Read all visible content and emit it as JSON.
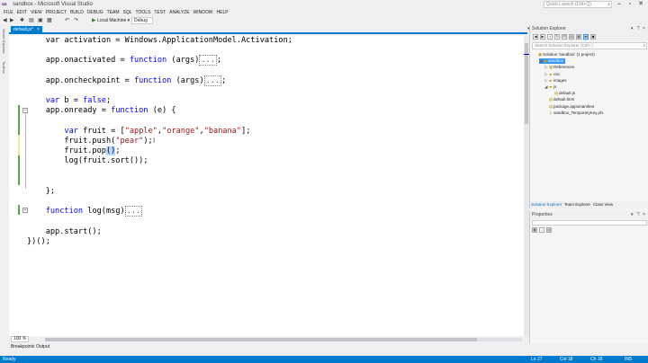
{
  "window": {
    "title": "sandbox - Microsoft Visual Studio",
    "quick_launch_placeholder": "Quick Launch (Ctrl+Q)",
    "logo": "visual-studio-logo"
  },
  "menu": [
    "FILE",
    "EDIT",
    "VIEW",
    "PROJECT",
    "BUILD",
    "DEBUG",
    "TEAM",
    "SQL",
    "TOOLS",
    "TEST",
    "ANALYZE",
    "WINDOW",
    "HELP"
  ],
  "toolbar": {
    "run_label": "Local Machine",
    "config": "Debug"
  },
  "left_strip": {
    "server_explorer": "Server Explorer",
    "toolbox": "Toolbox"
  },
  "editor": {
    "tab_label": "default.js*",
    "tab_close": "×",
    "lines": [
      {
        "parts": [
          [
            "t",
            "    var activation = Windows.ApplicationModel.Activation;"
          ]
        ]
      },
      {
        "parts": [
          [
            "t",
            ""
          ]
        ]
      },
      {
        "parts": [
          [
            "t",
            "    app.onactivated = "
          ],
          [
            "k",
            "function"
          ],
          [
            "t",
            " (args)"
          ],
          [
            "c",
            "..."
          ],
          [
            "t",
            ";"
          ]
        ]
      },
      {
        "parts": [
          [
            "t",
            ""
          ]
        ]
      },
      {
        "parts": [
          [
            "t",
            "    app.oncheckpoint = "
          ],
          [
            "k",
            "function"
          ],
          [
            "t",
            " (args)"
          ],
          [
            "c",
            "..."
          ],
          [
            "t",
            ";"
          ]
        ]
      },
      {
        "parts": [
          [
            "t",
            ""
          ]
        ]
      },
      {
        "parts": [
          [
            "t",
            "    "
          ],
          [
            "k",
            "var"
          ],
          [
            "t",
            " b = "
          ],
          [
            "k",
            "false"
          ],
          [
            "t",
            ";"
          ]
        ]
      },
      {
        "parts": [
          [
            "t",
            "    app.onready = "
          ],
          [
            "k",
            "function"
          ],
          [
            "t",
            " (e) {"
          ]
        ]
      },
      {
        "parts": [
          [
            "t",
            ""
          ]
        ]
      },
      {
        "parts": [
          [
            "t",
            "        "
          ],
          [
            "k",
            "var"
          ],
          [
            "t",
            " fruit = ["
          ],
          [
            "s",
            "\"apple\""
          ],
          [
            "t",
            ","
          ],
          [
            "s",
            "\"orange\""
          ],
          [
            "t",
            ","
          ],
          [
            "s",
            "\"banana\""
          ],
          [
            "t",
            "];"
          ]
        ]
      },
      {
        "parts": [
          [
            "t",
            "        fruit.push("
          ],
          [
            "s",
            "\"pear\""
          ],
          [
            "t",
            ");"
          ]
        ]
      },
      {
        "parts": [
          [
            "t",
            "        fruit.pop"
          ],
          [
            "h",
            "()"
          ],
          [
            "t",
            ";"
          ]
        ]
      },
      {
        "parts": [
          [
            "t",
            "        log(fruit.sort());"
          ]
        ]
      },
      {
        "parts": [
          [
            "t",
            ""
          ]
        ]
      },
      {
        "parts": [
          [
            "t",
            ""
          ]
        ]
      },
      {
        "parts": [
          [
            "t",
            "    };"
          ]
        ]
      },
      {
        "parts": [
          [
            "t",
            ""
          ]
        ]
      },
      {
        "parts": [
          [
            "t",
            "    "
          ],
          [
            "k",
            "function"
          ],
          [
            "t",
            " log(msg)"
          ],
          [
            "c",
            "..."
          ]
        ]
      },
      {
        "parts": [
          [
            "t",
            ""
          ]
        ]
      },
      {
        "parts": [
          [
            "t",
            "    app.start();"
          ]
        ]
      },
      {
        "parts": [
          [
            "t",
            "})();"
          ]
        ]
      }
    ],
    "zoom": "100 %",
    "outline_collapsed": "+",
    "outline_expanded": "−"
  },
  "bottom_tabs": [
    "Breakpoints",
    "Output"
  ],
  "status": {
    "left": "Ready",
    "ln": "Ln 27",
    "col": "Col 18",
    "ch": "Ch 18",
    "mode": "INS"
  },
  "solution_explorer": {
    "title": "Solution Explorer",
    "search_placeholder": "Search Solution Explorer (Ctrl+;)",
    "items": [
      {
        "label": "Solution 'sandbox' (1 project)",
        "indent": 0,
        "icon": "solution-icon",
        "exp": ""
      },
      {
        "label": "sandbox",
        "indent": 1,
        "icon": "project-icon",
        "exp": "◢",
        "selected": true
      },
      {
        "label": "References",
        "indent": 2,
        "icon": "references-icon",
        "exp": "▷"
      },
      {
        "label": "css",
        "indent": 2,
        "icon": "folder-icon",
        "exp": "▷"
      },
      {
        "label": "images",
        "indent": 2,
        "icon": "folder-icon",
        "exp": "▷"
      },
      {
        "label": "js",
        "indent": 2,
        "icon": "folder-icon",
        "exp": "◢"
      },
      {
        "label": "default.js",
        "indent": 3,
        "icon": "js-file-icon",
        "exp": ""
      },
      {
        "label": "default.html",
        "indent": 2,
        "icon": "html-file-icon",
        "exp": ""
      },
      {
        "label": "package.appxmanifest",
        "indent": 2,
        "icon": "manifest-icon",
        "exp": ""
      },
      {
        "label": "sandbox_TemporaryKey.pfx",
        "indent": 2,
        "icon": "key-icon",
        "exp": ""
      }
    ],
    "tabs": [
      "Solution Explorer",
      "Team Explorer",
      "Class View"
    ]
  },
  "properties": {
    "title": "Properties"
  },
  "colors": {
    "accent": "#007acc",
    "keyword": "#0000ff",
    "string": "#a31515",
    "change_saved": "#57a64a",
    "change_unsaved": "#efe9a0"
  }
}
